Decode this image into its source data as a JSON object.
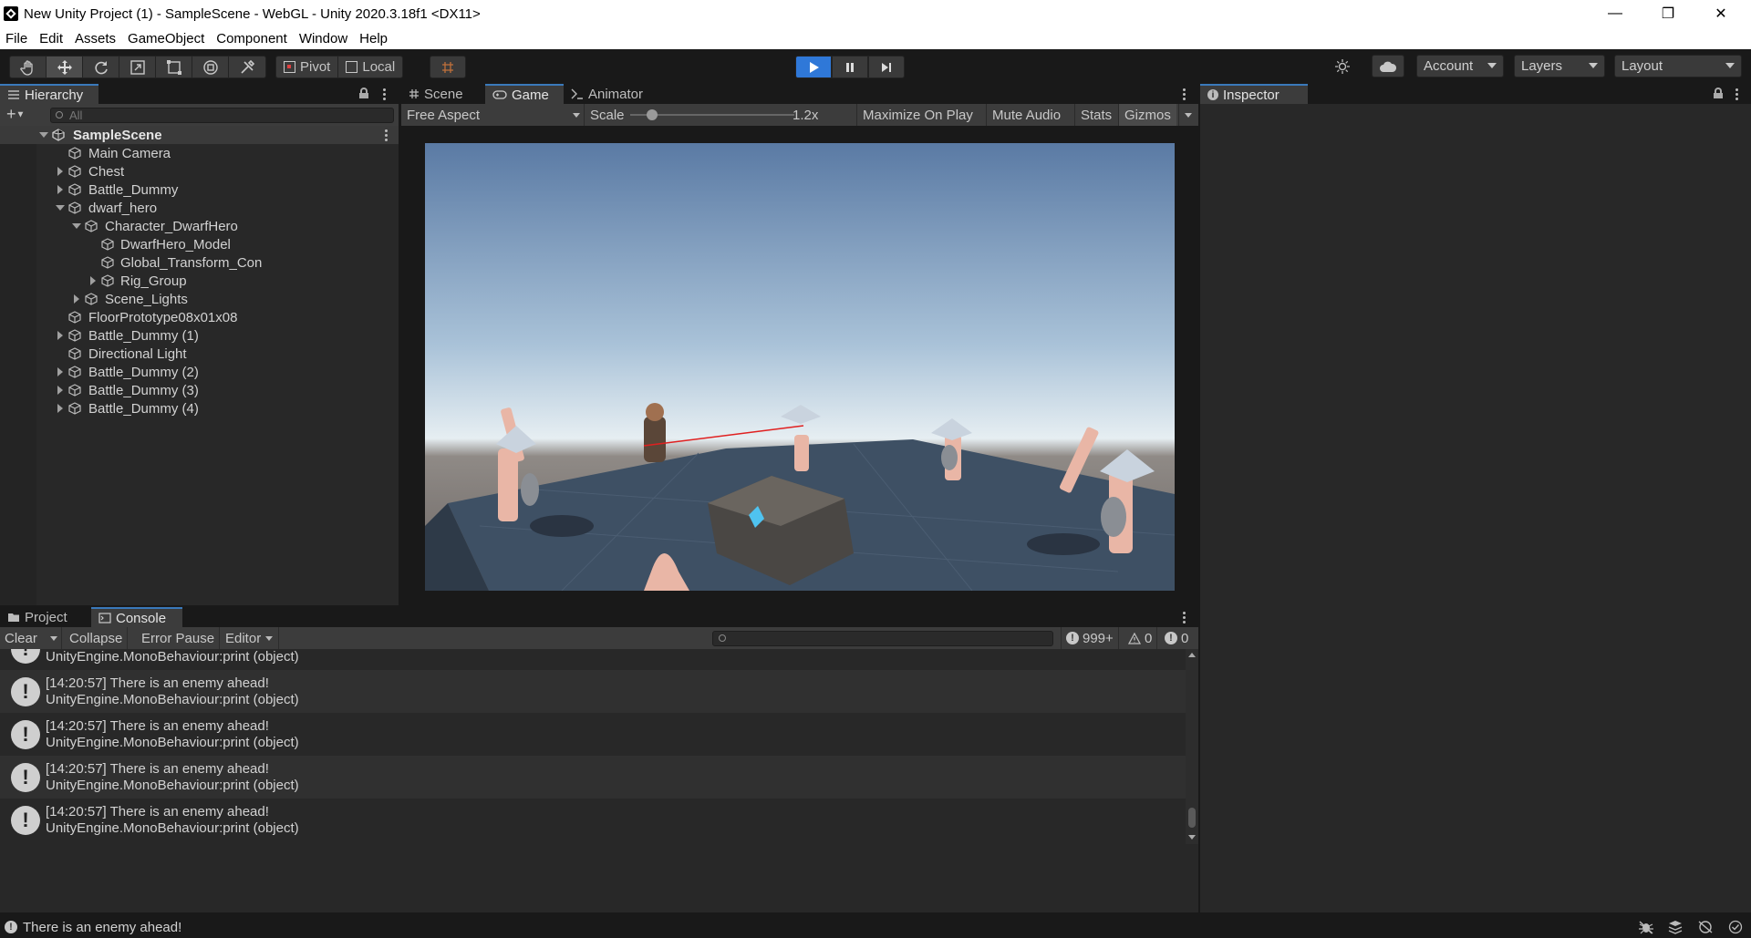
{
  "window": {
    "title": "New Unity Project (1) - SampleScene - WebGL - Unity 2020.3.18f1 <DX11>",
    "minimize": "—",
    "maximize": "❐",
    "close": "✕"
  },
  "menu": [
    "File",
    "Edit",
    "Assets",
    "GameObject",
    "Component",
    "Window",
    "Help"
  ],
  "toolbar": {
    "pivot_label": "Pivot",
    "local_label": "Local",
    "account_label": "Account",
    "layers_label": "Layers",
    "layout_label": "Layout",
    "play_state": "playing",
    "active_tool": "move"
  },
  "hierarchy": {
    "tab_label": "Hierarchy",
    "search_placeholder": "All",
    "scene_name": "SampleScene",
    "items": [
      {
        "label": "Main Camera"
      },
      {
        "label": "Chest"
      },
      {
        "label": "Battle_Dummy"
      },
      {
        "label": "dwarf_hero"
      },
      {
        "label": "Character_DwarfHero"
      },
      {
        "label": "DwarfHero_Model"
      },
      {
        "label": "Global_Transform_Con"
      },
      {
        "label": "Rig_Group"
      },
      {
        "label": "Scene_Lights"
      },
      {
        "label": "FloorPrototype08x01x08"
      },
      {
        "label": "Directional Light"
      },
      {
        "label": "Battle_Dummy (1)"
      },
      {
        "label": "Battle_Dummy (2)"
      },
      {
        "label": "Battle_Dummy (3)"
      },
      {
        "label": "Battle_Dummy (4)"
      }
    ]
  },
  "game_view": {
    "tabs": [
      "Scene",
      "Game",
      "Animator"
    ],
    "selected_tab": "Game",
    "aspect": "Free Aspect",
    "scale_label": "Scale",
    "scale_value": "1.2x",
    "maximize_on_play": "Maximize On Play",
    "mute_audio": "Mute Audio",
    "stats": "Stats",
    "gizmos": "Gizmos"
  },
  "inspector": {
    "tab_label": "Inspector"
  },
  "console": {
    "tabs": [
      "Project",
      "Console"
    ],
    "selected_tab": "Console",
    "clear": "Clear",
    "collapse": "Collapse",
    "error_pause": "Error Pause",
    "editor": "Editor",
    "log_count": "999+",
    "warn_count": "0",
    "error_count": "0",
    "top_partial_line": "UnityEngine.MonoBehaviour:print (object)",
    "entries": [
      {
        "message": "[14:20:57] There is an enemy ahead!",
        "stack": "UnityEngine.MonoBehaviour:print (object)"
      },
      {
        "message": "[14:20:57] There is an enemy ahead!",
        "stack": "UnityEngine.MonoBehaviour:print (object)"
      },
      {
        "message": "[14:20:57] There is an enemy ahead!",
        "stack": "UnityEngine.MonoBehaviour:print (object)"
      },
      {
        "message": "[14:20:57] There is an enemy ahead!",
        "stack": "UnityEngine.MonoBehaviour:print (object)"
      }
    ]
  },
  "status_bar": {
    "message": "There is an enemy ahead!"
  },
  "colors": {
    "play_active": "#2f78d8",
    "tab_highlight": "#3a79bb"
  }
}
